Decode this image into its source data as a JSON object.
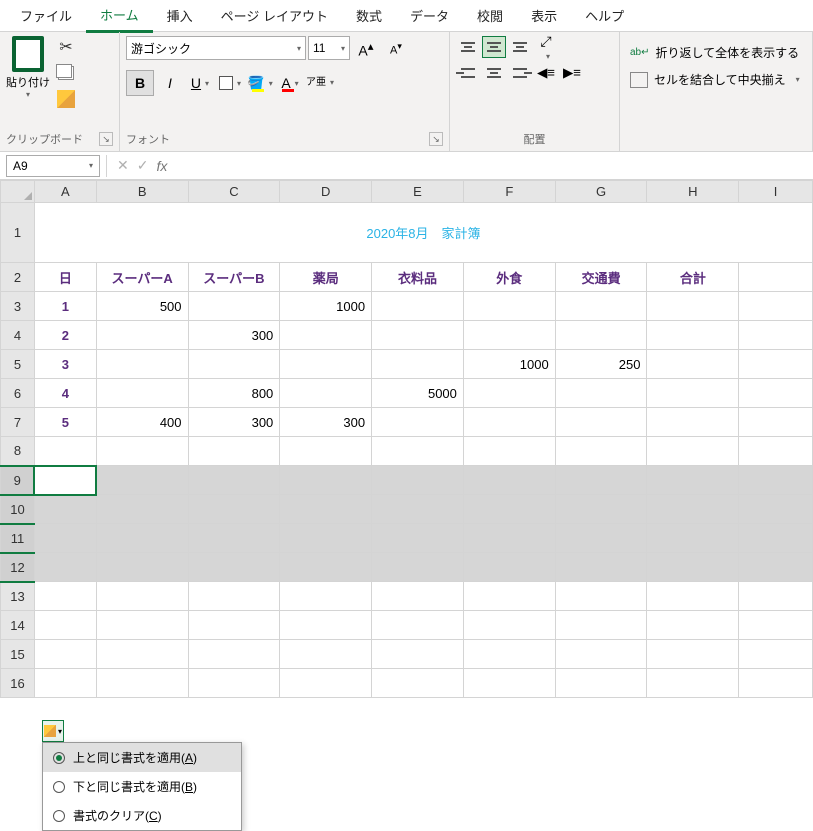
{
  "tabs": [
    "ファイル",
    "ホーム",
    "挿入",
    "ページ レイアウト",
    "数式",
    "データ",
    "校閲",
    "表示",
    "ヘルプ"
  ],
  "active_tab": 1,
  "clipboard": {
    "paste": "貼り付け",
    "label": "クリップボード"
  },
  "font": {
    "name": "游ゴシック",
    "size": "11",
    "label": "フォント",
    "bold": "B",
    "italic": "I",
    "underline": "U",
    "ruby": "ア亜"
  },
  "alignment": {
    "label": "配置"
  },
  "wrap": {
    "wrap_text": "折り返して全体を表示する",
    "merge": "セルを結合して中央揃え"
  },
  "name_box": "A9",
  "formula": "",
  "sheet": {
    "title": "2020年8月　家計簿",
    "headers": [
      "日",
      "スーパーA",
      "スーパーB",
      "薬局",
      "衣料品",
      "外食",
      "交通費",
      "合計"
    ],
    "rows": [
      {
        "day": "1",
        "b": "500",
        "c": "",
        "d": "1000",
        "e": "",
        "f": "",
        "g": ""
      },
      {
        "day": "2",
        "b": "",
        "c": "300",
        "d": "",
        "e": "",
        "f": "",
        "g": ""
      },
      {
        "day": "3",
        "b": "",
        "c": "",
        "d": "",
        "e": "",
        "f": "1000",
        "g": "250"
      },
      {
        "day": "4",
        "b": "",
        "c": "800",
        "d": "",
        "e": "5000",
        "f": "",
        "g": ""
      },
      {
        "day": "5",
        "b": "400",
        "c": "300",
        "d": "300",
        "e": "",
        "f": "",
        "g": ""
      }
    ]
  },
  "cols": [
    "A",
    "B",
    "C",
    "D",
    "E",
    "F",
    "G",
    "H",
    "I"
  ],
  "row_nums": [
    "1",
    "2",
    "3",
    "4",
    "5",
    "6",
    "7",
    "8",
    "9",
    "10",
    "11",
    "12",
    "13",
    "14",
    "15",
    "16"
  ],
  "autofill": {
    "opt1": "上と同じ書式を適用(",
    "opt1_key": "A",
    "opt2": "下と同じ書式を適用(",
    "opt2_key": "B",
    "opt3": "書式のクリア(",
    "opt3_key": "C",
    "close": ")"
  }
}
